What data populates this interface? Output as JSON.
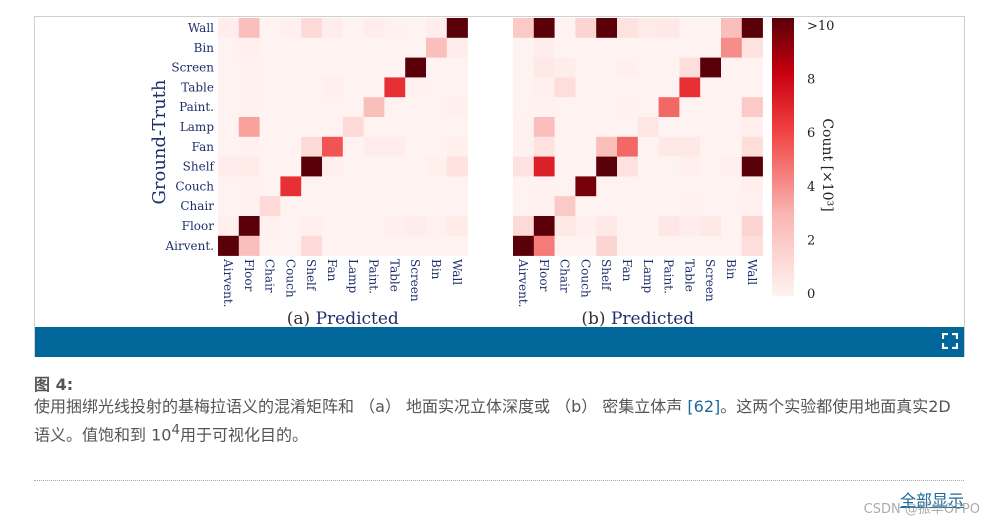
{
  "figure": {
    "expand_icon": "fullscreen-expand-icon",
    "accent_color": "#01679a"
  },
  "caption": {
    "title": "图 4:",
    "text_before": "使用捆绑光线投射的基梅拉语义的混淆矩阵和 （a） 地面实况立体深度或 （b） 密集立体声 ",
    "ref": "[62]",
    "text_middle": "。这两个实验都使用地面真实2D语义。值饱和到 10",
    "sup": "4",
    "text_after": "用于可视化目的。"
  },
  "show_all": "全部显示",
  "watermark": "CSDN @振华OPPO",
  "chart_data": [
    {
      "type": "heatmap",
      "title": "(a) Predicted",
      "xlabel": "Predicted",
      "panel": "(a)",
      "ylabel": "Ground-Truth",
      "columns": [
        "Airvent.",
        "Floor",
        "Chair",
        "Couch",
        "Shelf",
        "Fan",
        "Lamp",
        "Paint.",
        "Table",
        "Screen",
        "Bin",
        "Wall"
      ],
      "rows": [
        "Wall",
        "Bin",
        "Screen",
        "Table",
        "Paint.",
        "Lamp",
        "Fan",
        "Shelf",
        "Couch",
        "Chair",
        "Floor",
        "Airvent."
      ],
      "values": [
        [
          0.3,
          2.5,
          0,
          0.2,
          1.2,
          0.3,
          0,
          0.3,
          0.1,
          0,
          0.3,
          10
        ],
        [
          0,
          0.2,
          0,
          0,
          0,
          0,
          0,
          0,
          0,
          0,
          2.5,
          0.3
        ],
        [
          0,
          0.1,
          0,
          0,
          0,
          0,
          0,
          0,
          0,
          10,
          0,
          0
        ],
        [
          0,
          0.1,
          0,
          0,
          0,
          0.2,
          0,
          0,
          6.5,
          0.1,
          0,
          0
        ],
        [
          0,
          0.1,
          0,
          0,
          0,
          0,
          0,
          2.5,
          0,
          0,
          0,
          0.2
        ],
        [
          0,
          3.5,
          0,
          0,
          0,
          0,
          1.2,
          0,
          0,
          0,
          0,
          0
        ],
        [
          0,
          0.1,
          0,
          0,
          1.2,
          5.5,
          0,
          0.3,
          0.3,
          0,
          0,
          0.2
        ],
        [
          0.3,
          0.4,
          0,
          0,
          10,
          0.2,
          0,
          0,
          0,
          0,
          0.2,
          0.8
        ],
        [
          0,
          0.1,
          0,
          6.5,
          0,
          0,
          0,
          0,
          0,
          0,
          0,
          0
        ],
        [
          0,
          0.1,
          1.2,
          0,
          0,
          0,
          0,
          0,
          0,
          0,
          0,
          0
        ],
        [
          0.2,
          10,
          0.1,
          0,
          0.2,
          0,
          0,
          0,
          0.2,
          0.3,
          0.1,
          0.4
        ],
        [
          10,
          2.5,
          0,
          0,
          1.2,
          0,
          0,
          0,
          0,
          0,
          0,
          0
        ]
      ]
    },
    {
      "type": "heatmap",
      "title": "(b) Predicted",
      "xlabel": "Predicted",
      "panel": "(b)",
      "columns": [
        "Airvent.",
        "Floor",
        "Chair",
        "Couch",
        "Shelf",
        "Fan",
        "Lamp",
        "Paint.",
        "Table",
        "Screen",
        "Bin",
        "Wall"
      ],
      "rows": [
        "Wall",
        "Bin",
        "Screen",
        "Table",
        "Paint.",
        "Lamp",
        "Fan",
        "Shelf",
        "Couch",
        "Chair",
        "Floor",
        "Airvent."
      ],
      "values": [
        [
          2,
          10,
          0,
          1.5,
          10,
          0.8,
          0.4,
          0.5,
          0,
          0,
          2.5,
          10
        ],
        [
          0,
          0.3,
          0,
          0,
          0,
          0,
          0,
          0,
          0,
          0,
          4,
          0.8
        ],
        [
          0,
          0.5,
          0.3,
          0,
          0,
          0.2,
          0,
          0,
          1,
          10,
          0,
          0
        ],
        [
          0,
          0.2,
          1,
          0,
          0,
          0,
          0,
          0,
          6.5,
          0,
          0,
          0
        ],
        [
          0,
          0.1,
          0,
          0,
          0,
          0.1,
          0,
          5,
          0,
          0,
          0,
          2
        ],
        [
          0.1,
          2.5,
          0,
          0,
          0,
          0,
          0.6,
          0,
          0,
          0,
          0,
          0.2
        ],
        [
          0.1,
          0.8,
          0,
          0,
          2.5,
          5,
          0,
          0.5,
          0.5,
          0,
          0,
          1
        ],
        [
          0.8,
          7,
          0,
          0,
          10,
          0.8,
          0,
          0,
          0.2,
          0,
          0.2,
          10
        ],
        [
          0,
          0.1,
          0,
          9.5,
          0,
          0,
          0,
          0,
          0,
          0,
          0,
          0.2
        ],
        [
          0,
          0.1,
          2,
          0,
          0,
          0,
          0,
          0,
          0.1,
          0,
          0,
          0.1
        ],
        [
          1.2,
          10,
          0.5,
          0.2,
          0.5,
          0,
          0,
          0.6,
          0.3,
          0.5,
          0,
          1.5
        ],
        [
          10,
          4.5,
          0,
          0,
          1.5,
          0,
          0,
          0,
          0,
          0,
          0,
          1
        ]
      ]
    }
  ],
  "colorbar": {
    "label": "Count [×10³]",
    "range": [
      0,
      10
    ],
    "ticks": [
      "0",
      "2",
      "4",
      "6",
      "8",
      ">10"
    ],
    "colormap": "Reds"
  }
}
